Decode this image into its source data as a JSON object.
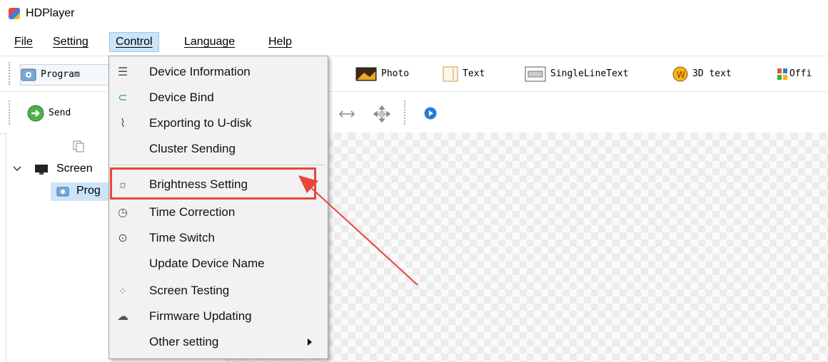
{
  "window": {
    "title": "HDPlayer"
  },
  "menubar": {
    "items": [
      "File",
      "Setting",
      "Control",
      "Language",
      "Help"
    ]
  },
  "toolbar1": {
    "program": "Program",
    "photo": "Photo",
    "text": "Text",
    "single_line_text": "SingleLineText",
    "text_3d": "3D text",
    "office": "Offi"
  },
  "toolbar2": {
    "send": "Send"
  },
  "tree": {
    "screen": "Screen",
    "program": "Prog"
  },
  "control_menu": {
    "items": [
      {
        "label": "Device Information",
        "icon": "list-icon"
      },
      {
        "label": "Device Bind",
        "icon": "magnet-icon"
      },
      {
        "label": "Exporting to U-disk",
        "icon": "usb-icon"
      },
      {
        "label": "Cluster Sending",
        "icon": ""
      },
      {
        "label": "Brightness Setting",
        "icon": "bulb-icon"
      },
      {
        "label": "Time Correction",
        "icon": "clock-icon"
      },
      {
        "label": "Time Switch",
        "icon": "toggle-icon"
      },
      {
        "label": "Update Device Name",
        "icon": ""
      },
      {
        "label": "Screen Testing",
        "icon": "dots-grid-icon"
      },
      {
        "label": "Firmware Updating",
        "icon": "cloud-icon"
      },
      {
        "label": "Other setting",
        "icon": ""
      }
    ]
  },
  "colors": {
    "annotation": "#e9453d",
    "selection": "#cce4f7"
  }
}
